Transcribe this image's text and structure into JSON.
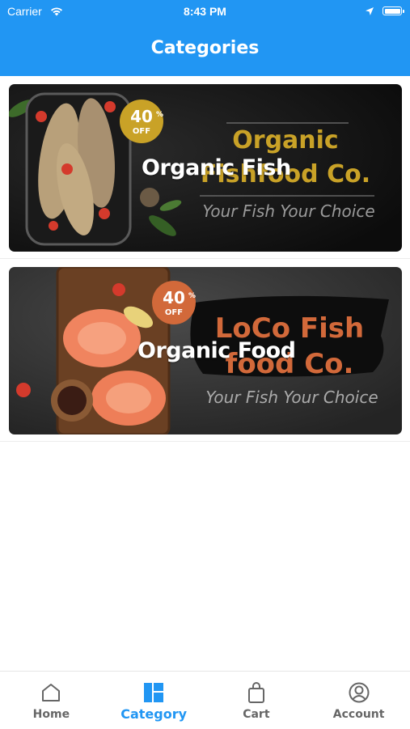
{
  "status": {
    "carrier": "Carrier",
    "time": "8:43 PM"
  },
  "header": {
    "title": "Categories"
  },
  "categories": [
    {
      "title": "Organic Fish",
      "banner": {
        "badge_number": "40",
        "badge_percent": "%",
        "badge_off": "OFF",
        "line1": "Organic",
        "line2": "Fishfood Co.",
        "tagline": "Your Fish Your Choice",
        "brand_color": "#c9a227"
      }
    },
    {
      "title": "Organic Food",
      "banner": {
        "badge_number": "40",
        "badge_percent": "%",
        "badge_off": "OFF",
        "line1": "LoCo Fish",
        "line2": "food Co.",
        "tagline": "Your Fish Your Choice",
        "brand_color": "#d2693a"
      }
    }
  ],
  "tabs": [
    {
      "label": "Home",
      "icon": "home-icon"
    },
    {
      "label": "Category",
      "icon": "category-icon"
    },
    {
      "label": "Cart",
      "icon": "cart-bag-icon"
    },
    {
      "label": "Account",
      "icon": "account-icon"
    }
  ],
  "colors": {
    "primary": "#2196f3",
    "inactive": "#666666"
  }
}
